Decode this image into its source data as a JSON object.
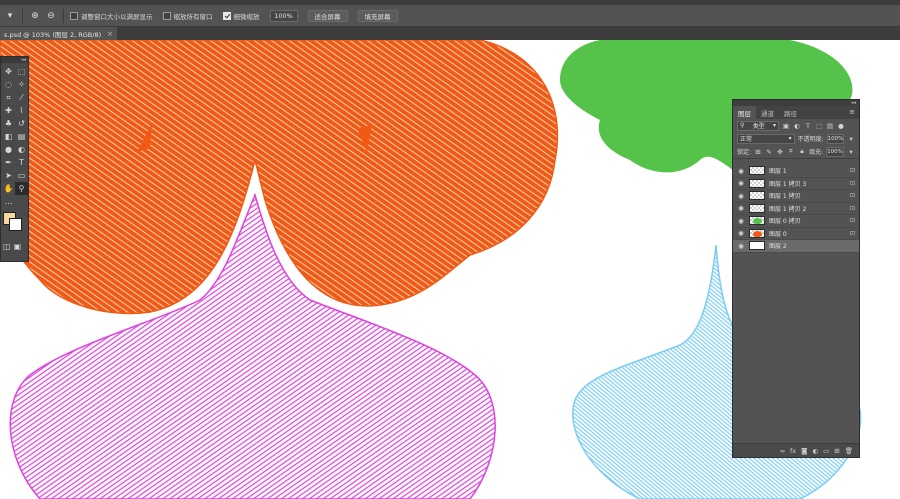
{
  "options_bar": {
    "checkbox_resize": "调整窗口大小以满屏显示",
    "checkbox_zoom_all": "缩放所有窗口",
    "checkbox_scrubby": "细微缩放",
    "zoom_value": "100%",
    "btn_fit_screen": "适合屏幕",
    "btn_fill_screen": "填充屏幕"
  },
  "document": {
    "tab_title": "s.psd @ 103% (图层 2, RGB/8)",
    "close_glyph": "×"
  },
  "layers_panel": {
    "tabs": [
      "图层",
      "通道",
      "路径"
    ],
    "kind_label": "类型",
    "blend_mode": "正常",
    "opacity_label": "不透明度:",
    "opacity_value": "100%",
    "lock_label": "锁定:",
    "fill_label": "填充:",
    "fill_value": "100%",
    "layers": [
      {
        "name": "图层 1",
        "thumb": "transparent"
      },
      {
        "name": "图层 1 拷贝 3",
        "thumb": "transparent"
      },
      {
        "name": "图层 1 拷贝",
        "thumb": "transparent"
      },
      {
        "name": "图层 1 拷贝 2",
        "thumb": "transparent"
      },
      {
        "name": "图层 0 拷贝",
        "thumb": "green"
      },
      {
        "name": "图层 0",
        "thumb": "orange"
      },
      {
        "name": "图层 2",
        "thumb": "white"
      }
    ]
  },
  "colors": {
    "orange": "#f05a14",
    "pink": "#e040e0",
    "green": "#55c24a",
    "blue": "#7ccdf5",
    "foreground": "#f6d9a0",
    "background": "#ffffff"
  }
}
